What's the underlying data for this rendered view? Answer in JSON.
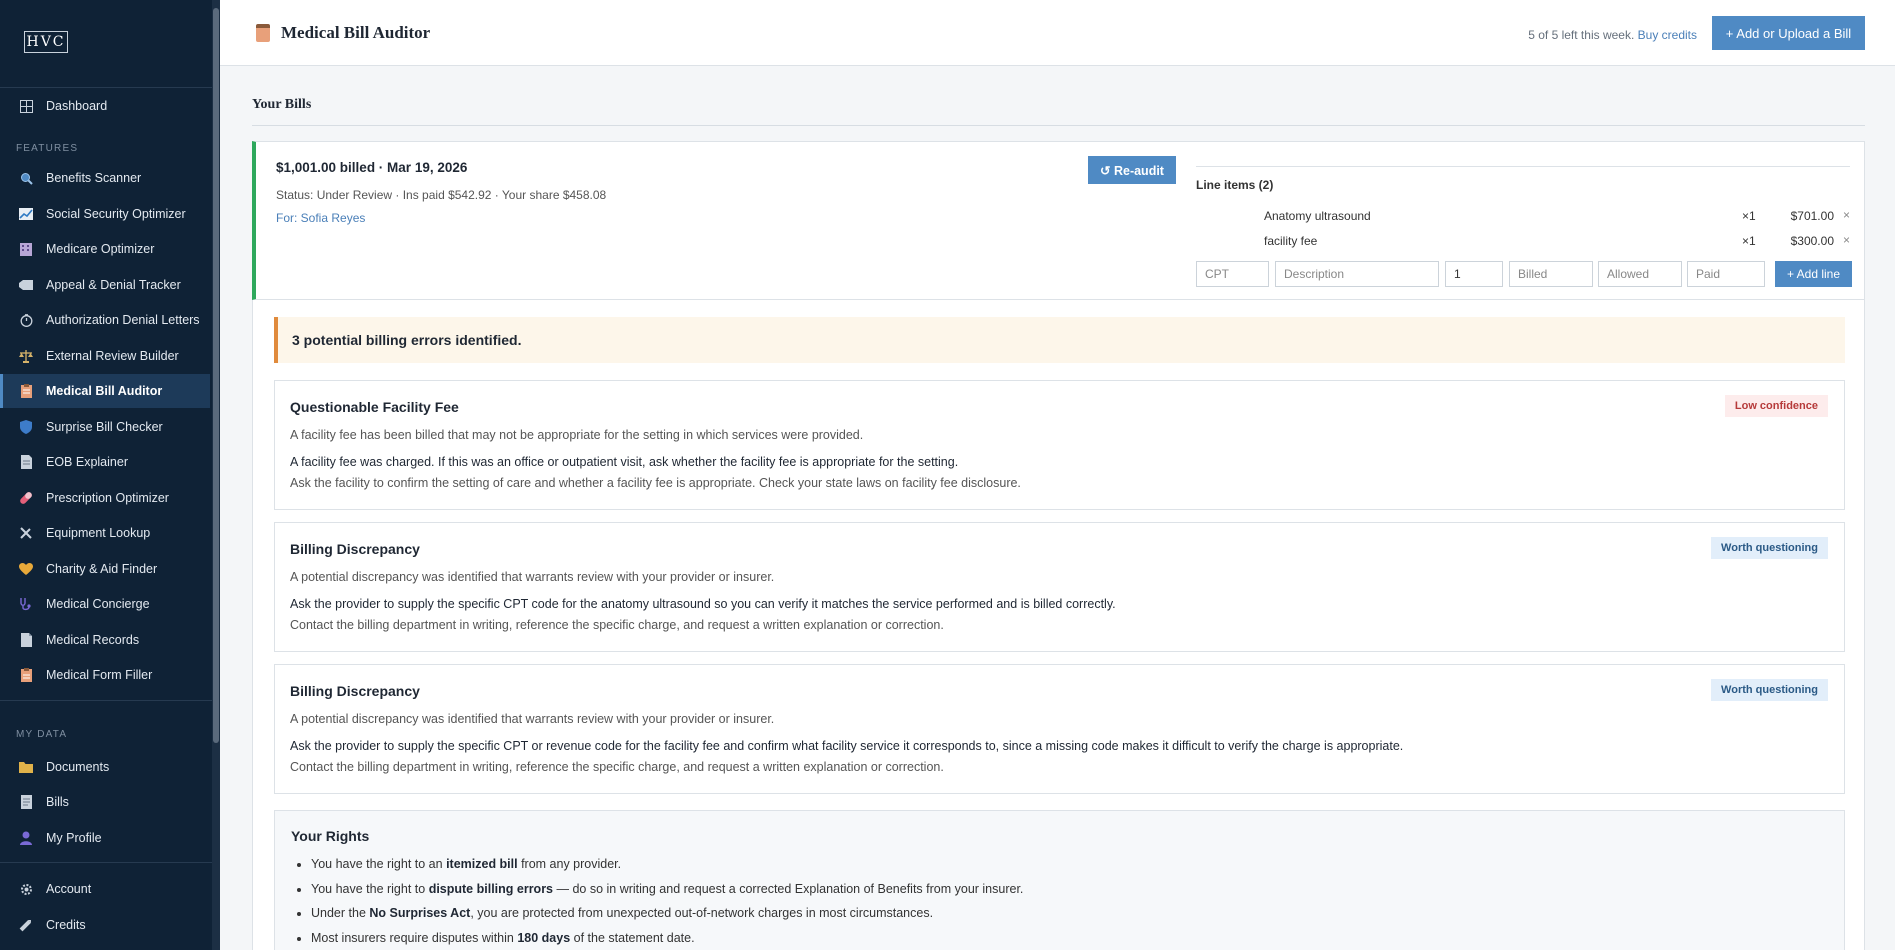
{
  "sidebar": {
    "logo": "HVC",
    "features_label": "FEATURES",
    "mydata_label": "MY DATA",
    "dashboard": "Dashboard",
    "features": [
      {
        "label": "Benefits Scanner",
        "icon": "magnifier-icon"
      },
      {
        "label": "Social Security Optimizer",
        "icon": "chart-icon"
      },
      {
        "label": "Medicare Optimizer",
        "icon": "building-icon"
      },
      {
        "label": "Appeal & Denial Tracker",
        "icon": "tag-icon"
      },
      {
        "label": "Authorization Denial Letters",
        "icon": "stopwatch-icon"
      },
      {
        "label": "External Review Builder",
        "icon": "scales-icon"
      },
      {
        "label": "Medical Bill Auditor",
        "icon": "clipboard-icon",
        "active": true
      },
      {
        "label": "Surprise Bill Checker",
        "icon": "shield-icon"
      },
      {
        "label": "EOB Explainer",
        "icon": "document-icon"
      },
      {
        "label": "Prescription Optimizer",
        "icon": "pill-icon"
      },
      {
        "label": "Equipment Lookup",
        "icon": "tools-icon"
      },
      {
        "label": "Charity & Aid Finder",
        "icon": "heart-icon"
      },
      {
        "label": "Medical Concierge",
        "icon": "stethoscope-icon"
      },
      {
        "label": "Medical Records",
        "icon": "page-icon"
      },
      {
        "label": "Medical Form Filler",
        "icon": "form-icon"
      }
    ],
    "mydata": [
      {
        "label": "Documents",
        "icon": "folder-icon"
      },
      {
        "label": "Bills",
        "icon": "receipt-icon"
      },
      {
        "label": "My Profile",
        "icon": "user-icon"
      }
    ],
    "account": "Account",
    "credits": "Credits"
  },
  "header": {
    "title": "Medical Bill Auditor",
    "credits_text": "5 of 5 left this week.",
    "buy_credits": "Buy credits",
    "add_button": "+ Add or Upload a Bill"
  },
  "bills": {
    "heading": "Your Bills",
    "bill": {
      "amount_line": "$1,001.00 billed · Mar 19, 2026",
      "status_line": "Status: Under Review · Ins paid $542.92 · Your share $458.08",
      "for_line": "For: Sofia Reyes",
      "reaudit": "↺ Re-audit",
      "line_items_heading": "Line items (2)",
      "line_items": [
        {
          "description": "Anatomy ultrasound",
          "qty": "×1",
          "amount": "$701.00"
        },
        {
          "description": "facility fee",
          "qty": "×1",
          "amount": "$300.00"
        }
      ],
      "delete_glyph": "×",
      "new_line": {
        "cpt_placeholder": "CPT",
        "description_placeholder": "Description",
        "qty_value": "1",
        "billed_placeholder": "Billed",
        "allowed_placeholder": "Allowed",
        "paid_placeholder": "Paid",
        "add_line": "+ Add line"
      }
    }
  },
  "audit": {
    "alert": "3 potential billing errors identified.",
    "findings": [
      {
        "title": "Questionable Facility Fee",
        "badge": "Low confidence",
        "badge_type": "low",
        "description": "A facility fee has been billed that may not be appropriate for the setting in which services were provided.",
        "detail": "A facility fee was charged. If this was an office or outpatient visit, ask whether the facility fee is appropriate for the setting.",
        "action": "Ask the facility to confirm the setting of care and whether a facility fee is appropriate. Check your state laws on facility fee disclosure."
      },
      {
        "title": "Billing Discrepancy",
        "badge": "Worth questioning",
        "badge_type": "worth",
        "description": "A potential discrepancy was identified that warrants review with your provider or insurer.",
        "detail": "Ask the provider to supply the specific CPT code for the anatomy ultrasound so you can verify it matches the service performed and is billed correctly.",
        "action": "Contact the billing department in writing, reference the specific charge, and request a written explanation or correction."
      },
      {
        "title": "Billing Discrepancy",
        "badge": "Worth questioning",
        "badge_type": "worth",
        "description": "A potential discrepancy was identified that warrants review with your provider or insurer.",
        "detail": "Ask the provider to supply the specific CPT or revenue code for the facility fee and confirm what facility service it corresponds to, since a missing code makes it difficult to verify the charge is appropriate.",
        "action": "Contact the billing department in writing, reference the specific charge, and request a written explanation or correction."
      }
    ],
    "rights": {
      "title": "Your Rights",
      "items": [
        {
          "pre": "You have the right to an ",
          "bold": "itemized bill",
          "post": " from any provider."
        },
        {
          "pre": "You have the right to ",
          "bold": "dispute billing errors",
          "post": " — do so in writing and request a corrected Explanation of Benefits from your insurer."
        },
        {
          "pre": "Under the ",
          "bold": "No Surprises Act",
          "post": ", you are protected from unexpected out-of-network charges in most circumstances."
        },
        {
          "pre": "Most insurers require disputes within ",
          "bold": "180 days",
          "post": " of the statement date."
        }
      ]
    }
  },
  "colors": {
    "sidebar_bg": "#0f2236",
    "accent": "#4f8ac4",
    "success": "#2ea85c",
    "warning": "#e08a3c"
  }
}
